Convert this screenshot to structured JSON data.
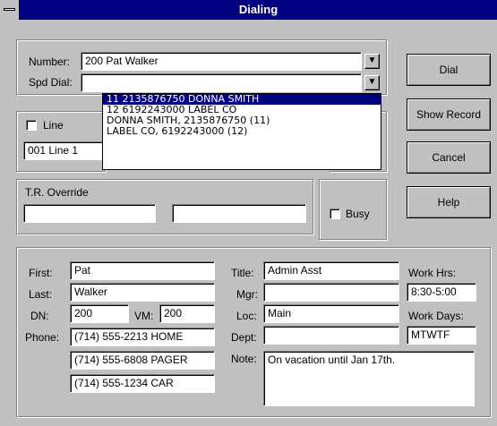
{
  "window": {
    "title": "Dialing"
  },
  "dial_group": {
    "number_label": "Number:",
    "number_value": "200 Pat Walker",
    "spd_dial_label": "Spd Dial:",
    "spd_dial_value": "",
    "dropdown_arrow": "down-arrow-icon"
  },
  "spd_dial_list": {
    "items": [
      "11  2135876750  DONNA SMITH",
      "12  6192243000  LABEL CO",
      "DONNA SMITH,  2135876750  (11)",
      "LABEL CO,  6192243000  (12)"
    ],
    "selected_index": 0
  },
  "line_group": {
    "line_checkbox_label": "Line",
    "line_checked": false,
    "line_value": "001 Line  1"
  },
  "tr_group": {
    "tr_override_label": "T.R. Override",
    "field1": "",
    "field2": "",
    "busy_label": "Busy",
    "busy_checked": false
  },
  "buttons": {
    "dial": "Dial",
    "show_record": "Show Record",
    "cancel": "Cancel",
    "help": "Help"
  },
  "record": {
    "first_label": "First:",
    "first_value": "Pat",
    "last_label": "Last:",
    "last_value": "Walker",
    "dn_label": "DN:",
    "dn_value": "200",
    "vm_label": "VM:",
    "vm_value": "200",
    "phone_label": "Phone:",
    "phones": [
      "(714) 555-2213 HOME",
      "(714) 555-6808 PAGER",
      "(714) 555-1234 CAR"
    ],
    "title_label": "Title:",
    "title_value": "Admin Asst",
    "mgr_label": "Mgr:",
    "mgr_value": "",
    "loc_label": "Loc:",
    "loc_value": "Main",
    "dept_label": "Dept:",
    "dept_value": "",
    "note_label": "Note:",
    "note_value": "On vacation until Jan 17th.",
    "work_hrs_label": "Work Hrs:",
    "work_hrs_value": "8:30-5:00",
    "work_days_label": "Work Days:",
    "work_days_value": "MTWTF"
  }
}
